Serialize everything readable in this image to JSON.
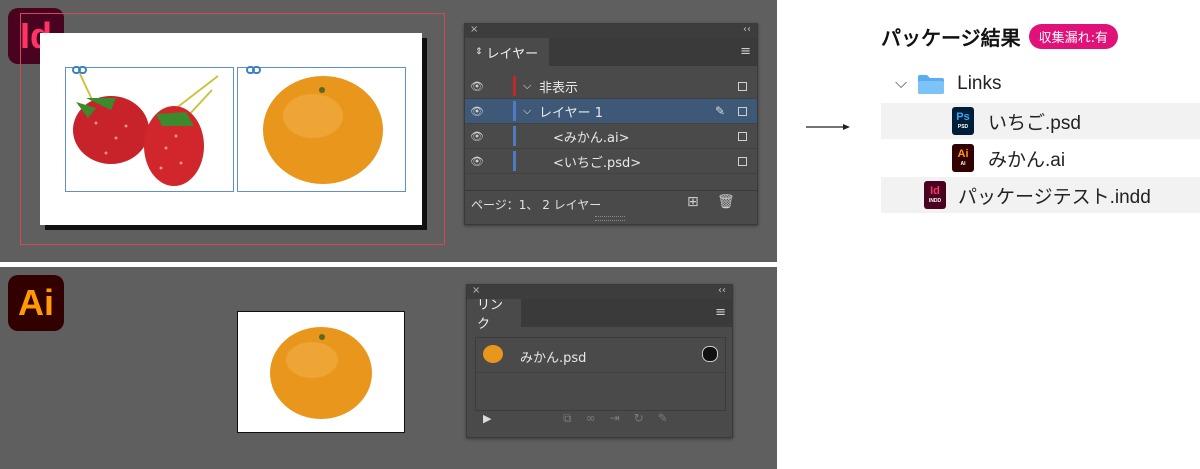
{
  "indesign": {
    "app_badge": "Id",
    "colors": {
      "badge_bg": "#49021f",
      "badge_fg": "#ff3366"
    },
    "layers_panel": {
      "tab": "レイヤー",
      "close": "×",
      "collapse": "‹‹",
      "layers": [
        {
          "name": "非表示",
          "color": "#c0282d",
          "selected": false
        },
        {
          "name": "レイヤー 1",
          "color": "#4d7cc4",
          "selected": true
        },
        {
          "name": "<みかん.ai>",
          "color": "#4d7cc4",
          "selected": false,
          "child": true
        },
        {
          "name": "<いちご.psd>",
          "color": "#4d7cc4",
          "selected": false,
          "child": true
        }
      ],
      "footer": "ページ：1、 2 レイヤー"
    }
  },
  "illustrator": {
    "app_badge": "Ai",
    "colors": {
      "badge_bg": "#330000",
      "badge_fg": "#ff9a00"
    },
    "links_panel": {
      "tab": "リンク",
      "close": "×",
      "collapse": "‹‹",
      "items": [
        {
          "name": "みかん.psd"
        }
      ]
    }
  },
  "package": {
    "title": "パッケージ結果",
    "badge": "収集漏れ:有",
    "badge_color": "#e0127a",
    "arrow": "→",
    "folder": {
      "name": "Links",
      "expanded": true
    },
    "files": [
      {
        "name": "いちご.psd",
        "icon": "Ps",
        "icon_sub": "PSD",
        "icon_bg": "#001e36",
        "icon_fg": "#31a8ff"
      },
      {
        "name": "みかん.ai",
        "icon": "Ai",
        "icon_sub": "AI",
        "icon_bg": "#330000",
        "icon_fg": "#ff9a00"
      }
    ],
    "document": {
      "name": "パッケージテスト.indd",
      "icon": "Id",
      "icon_sub": "INDD",
      "icon_bg": "#49021f",
      "icon_fg": "#ff3366"
    }
  }
}
